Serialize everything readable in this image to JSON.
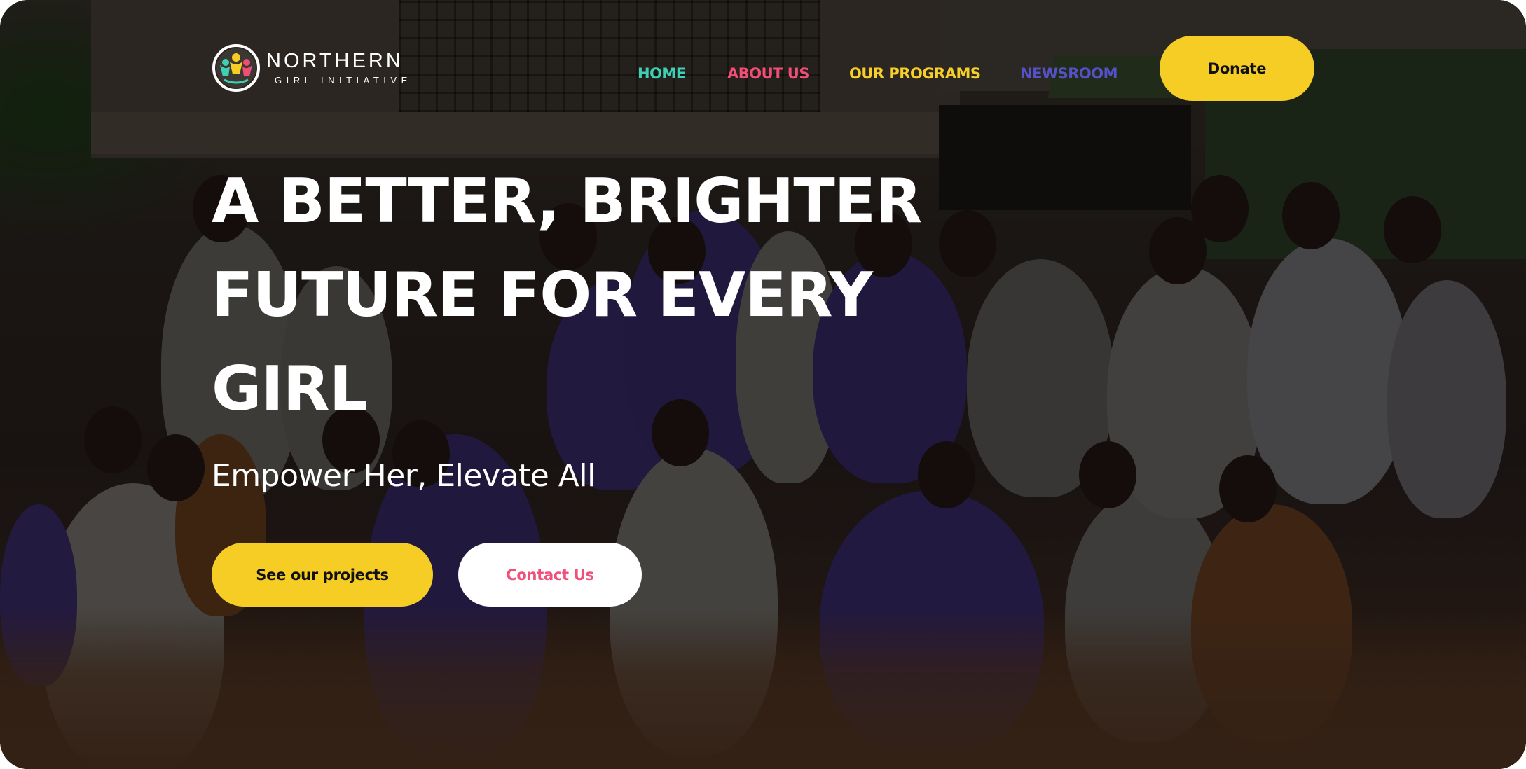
{
  "brand": {
    "name_line1": "NORTHERN",
    "name_line2": "GIRL INITIATIVE",
    "logo_icon": "people-circle-logo"
  },
  "nav": {
    "items": [
      {
        "label": "HOME",
        "color": "#3fd0b4"
      },
      {
        "label": "ABOUT US",
        "color": "#f04e76"
      },
      {
        "label": "OUR PROGRAMS",
        "color": "#f6cf29"
      },
      {
        "label": "NEWSROOM",
        "color": "#5651c8"
      }
    ],
    "donate_label": "Donate"
  },
  "hero": {
    "headline_lines": [
      "A BETTER, BRIGHTER",
      "FUTURE FOR EVERY",
      "GIRL"
    ],
    "tagline": "Empower Her, Elevate All",
    "primary_cta": "See our projects",
    "secondary_cta": "Contact Us",
    "background_image": "group-of-smiling-girls-photo"
  },
  "colors": {
    "accent_yellow": "#f6cd24",
    "accent_pink": "#f0507a",
    "accent_teal": "#3fd0b4",
    "accent_indigo": "#5651c8"
  }
}
